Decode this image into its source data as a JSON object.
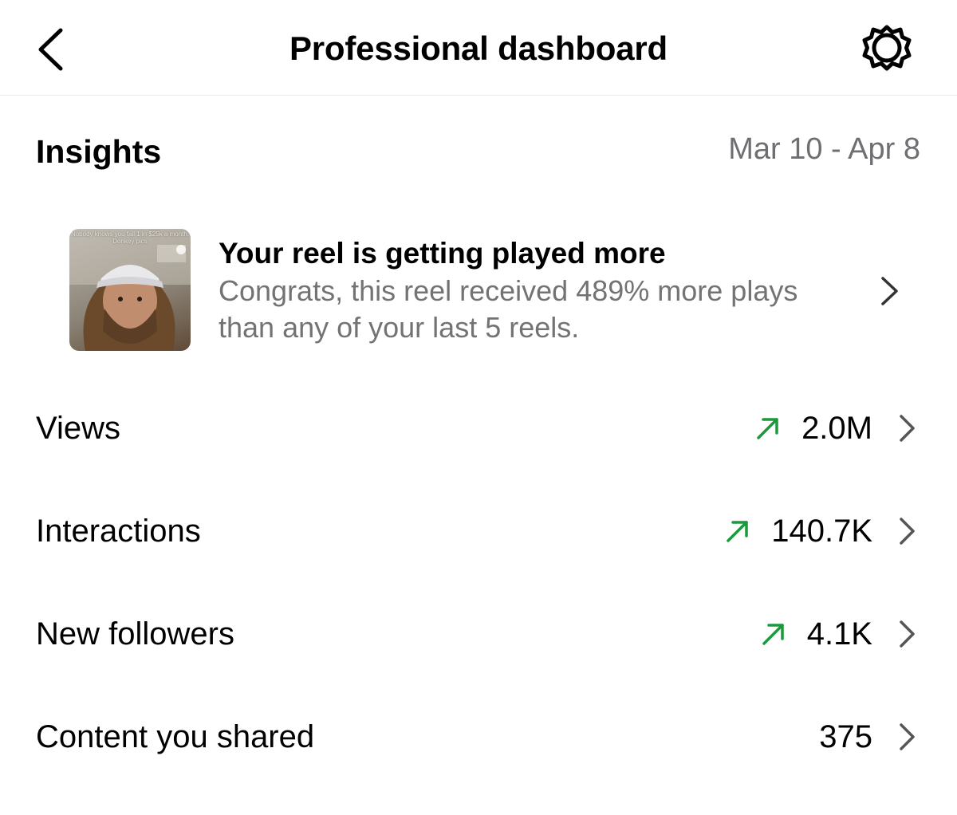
{
  "header": {
    "title": "Professional dashboard",
    "back_icon": "chevron-left-icon",
    "settings_icon": "gear-icon"
  },
  "insights": {
    "title": "Insights",
    "date_range": "Mar 10 - Apr 8"
  },
  "reel_card": {
    "title": "Your reel is getting played more",
    "body": "Congrats, this reel received 489% more plays than any of your last 5 reels.",
    "thumbnail_caption": "Nobody knows you fail 1 in $25k a month. Donkey pics"
  },
  "metrics": [
    {
      "label": "Views",
      "value": "2.0M",
      "trend": "up"
    },
    {
      "label": "Interactions",
      "value": "140.7K",
      "trend": "up"
    },
    {
      "label": "New followers",
      "value": "4.1K",
      "trend": "up"
    },
    {
      "label": "Content you shared",
      "value": "375",
      "trend": "none"
    }
  ],
  "colors": {
    "trend_up": "#1a9a3c",
    "secondary_text": "#737373",
    "divider": "#ebebeb"
  }
}
